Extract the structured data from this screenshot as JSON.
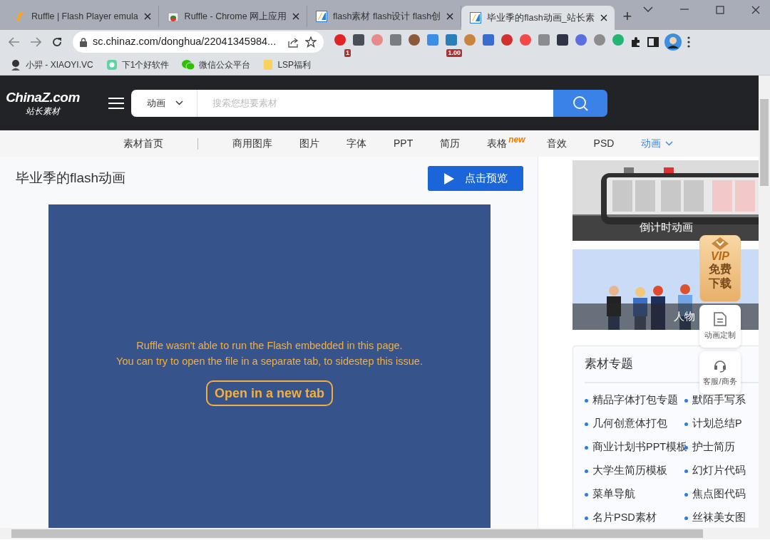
{
  "browser": {
    "tabs": [
      {
        "title": "Ruffle | Flash Player emula",
        "kind": "ruffle",
        "selected": false
      },
      {
        "title": "Ruffle - Chrome 网上应用",
        "kind": "store",
        "selected": false
      },
      {
        "title": "flash素材 flash设计 flash创",
        "kind": "site",
        "selected": false
      },
      {
        "title": "毕业季的flash动画_站长素",
        "kind": "site",
        "selected": true
      }
    ],
    "new_tab": "+",
    "url": "sc.chinaz.com/donghua/22041345984...",
    "extensions": [
      {
        "kind": "circle",
        "color": "#e02424",
        "badge": "1"
      },
      {
        "kind": "square",
        "color": "#4a4f57"
      },
      {
        "kind": "circle",
        "color": "#e88a8a"
      },
      {
        "kind": "square",
        "color": "#7a7d82"
      },
      {
        "kind": "circle",
        "color": "#8a5a3c"
      },
      {
        "kind": "square",
        "color": "#3a8ee6"
      },
      {
        "kind": "square",
        "color": "#2a7fb8",
        "badge": "1.00"
      },
      {
        "kind": "circle",
        "color": "#c8843c"
      },
      {
        "kind": "square",
        "color": "#3a6bd0"
      },
      {
        "kind": "circle",
        "color": "#d32f2f"
      },
      {
        "kind": "circle",
        "color": "#f44848"
      },
      {
        "kind": "square",
        "color": "#8a8c90"
      },
      {
        "kind": "square",
        "color": "#2f3547"
      },
      {
        "kind": "circle",
        "color": "#5b6ee1"
      },
      {
        "kind": "circle",
        "color": "#8c8c8c"
      },
      {
        "kind": "circle",
        "color": "#22b573"
      }
    ],
    "bookmarks": [
      {
        "label": "小羿 - XIAOYI.VC",
        "kind": "avatar"
      },
      {
        "label": "下1个好软件",
        "kind": "app"
      },
      {
        "label": "微信公众平台",
        "kind": "chat"
      },
      {
        "label": "LSP福利",
        "kind": "folder"
      }
    ]
  },
  "site": {
    "logo": "ChinaZ.com",
    "logo_sub": "站长素材",
    "search": {
      "category": "动画",
      "placeholder": "搜索您想要素材"
    },
    "nav": [
      {
        "label": "素材首页",
        "selected": false
      },
      {
        "label": "商用图库",
        "selected": false
      },
      {
        "label": "图片",
        "selected": false
      },
      {
        "label": "字体",
        "selected": false
      },
      {
        "label": "PPT",
        "selected": false
      },
      {
        "label": "简历",
        "selected": false
      },
      {
        "label": "表格",
        "selected": false,
        "badge": "new"
      },
      {
        "label": "音效",
        "selected": false
      },
      {
        "label": "PSD",
        "selected": false
      },
      {
        "label": "动画",
        "selected": true,
        "dropdown": true
      }
    ]
  },
  "page": {
    "title": "毕业季的flash动画",
    "preview_button": "点击预览",
    "player": {
      "messages": [
        "Ruffle wasn't able to run the Flash embedded in this page.",
        "You can try to open the file in a separate tab, to sidestep this issue."
      ],
      "button": "Open in a new tab"
    }
  },
  "sidebar": {
    "cards": [
      {
        "caption": "倒计时动画",
        "kind": "clock"
      },
      {
        "caption": "人物",
        "kind": "people"
      }
    ],
    "vip": {
      "top": "VIP",
      "lines": [
        "免费",
        "下载"
      ]
    },
    "float_buttons": [
      {
        "label": "动画定制",
        "kind": "doc"
      },
      {
        "label": "客服/商务",
        "kind": "headset"
      }
    ],
    "topics": {
      "title": "素材专题",
      "items": [
        "精品字体打包专题",
        "默陌手写系",
        "几何创意体打包",
        "计划总结P",
        "商业计划书PPT模板",
        "护士简历",
        "大学生简历模板",
        "幻灯片代码",
        "菜单导航",
        "焦点图代码",
        "名片PSD素材",
        "丝袜美女图"
      ]
    }
  }
}
